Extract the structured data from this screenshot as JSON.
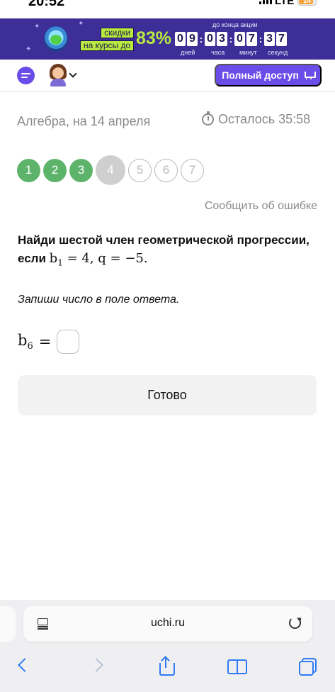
{
  "status_bar": {
    "time": "20:52",
    "network": "LTE",
    "battery": "14"
  },
  "promo": {
    "label_discount": "скидки",
    "label_courses": "на курсы до",
    "percent": "83%",
    "countdown_caption": "до конца акции",
    "digits": [
      "0",
      "9",
      "0",
      "3",
      "0",
      "7",
      "3",
      "7"
    ],
    "units": [
      "дней",
      "часа",
      "минут",
      "секунд"
    ],
    "colors": {
      "bg": "#3d2f97",
      "accent": "#b9ea3f"
    }
  },
  "header": {
    "full_access_label": "Полный доступ",
    "accent_color": "#6a4de8",
    "icons": [
      "chat-icon",
      "avatar",
      "chevron-down-icon",
      "cart-icon"
    ]
  },
  "lesson": {
    "title": "Алгебра, на 14 апреля",
    "timer_text": "Осталось 35:58"
  },
  "progress": {
    "steps": [
      {
        "label": "1",
        "state": "done"
      },
      {
        "label": "2",
        "state": "done"
      },
      {
        "label": "3",
        "state": "done"
      },
      {
        "label": "4",
        "state": "current"
      },
      {
        "label": "5",
        "state": "todo"
      },
      {
        "label": "6",
        "state": "todo"
      },
      {
        "label": "7",
        "state": "todo"
      }
    ],
    "colors": {
      "done": "#5eb36b",
      "current": "#cfcfcf"
    }
  },
  "report_link": "Сообщить об ошибке",
  "question": {
    "text": "Найди шестой член геометрической прогрессии, если",
    "b_symbol": "b",
    "b_index": "1",
    "b_value": "= 4,",
    "q_text": "q = −5.",
    "hint": "Запиши число в поле ответа."
  },
  "answer": {
    "symbol": "b",
    "index": "6",
    "equals": "=",
    "value": "",
    "placeholder": ""
  },
  "ready_button": "Готово",
  "browser": {
    "url": "uchi.ru",
    "icons": [
      "reader-icon",
      "reload-icon",
      "back-icon",
      "forward-icon",
      "share-icon",
      "bookmarks-icon",
      "tabs-icon"
    ]
  }
}
